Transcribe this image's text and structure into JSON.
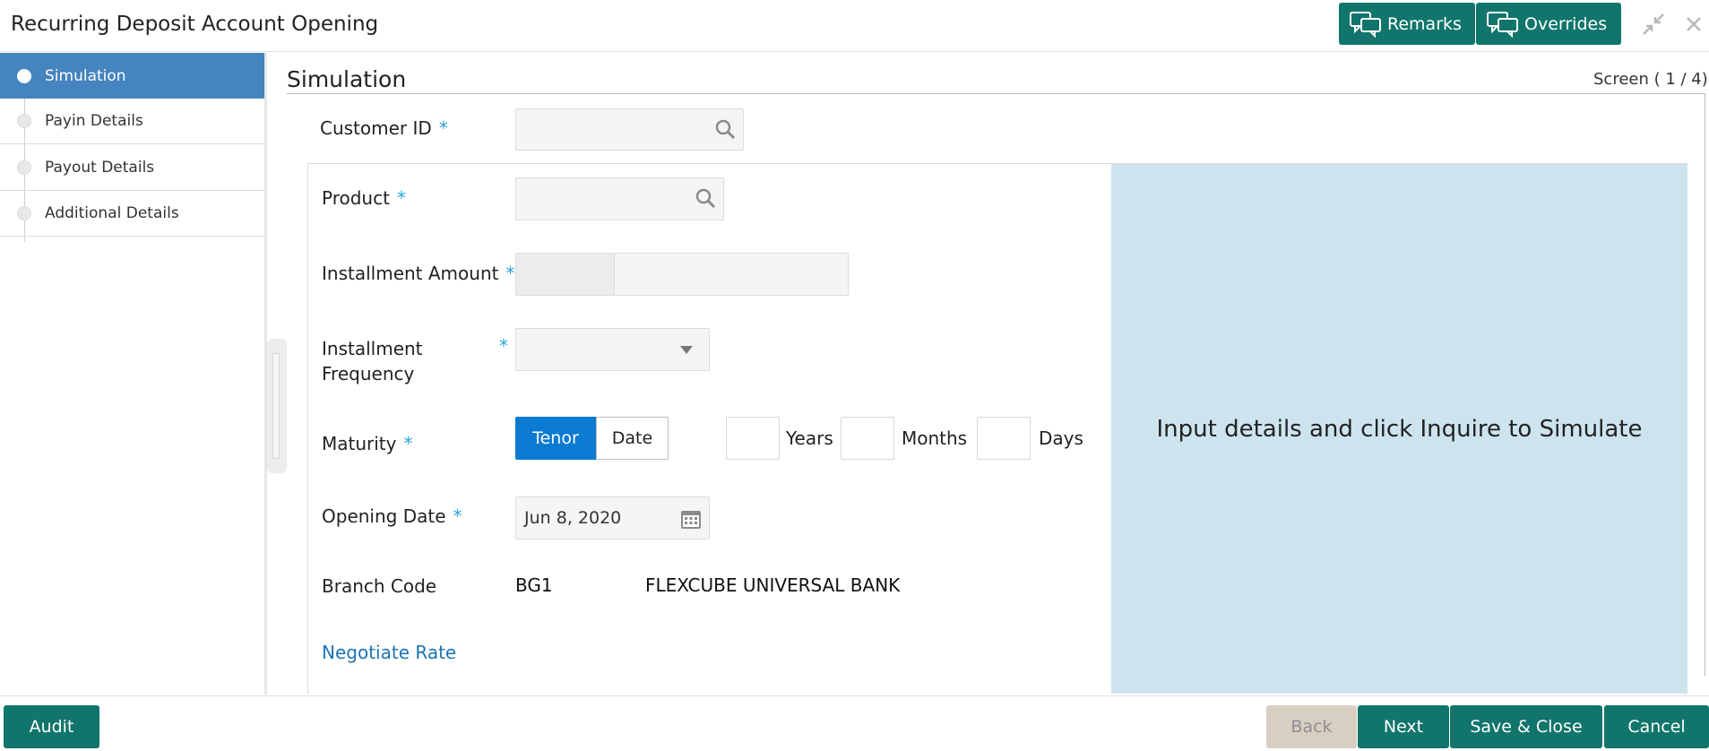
{
  "header": {
    "title": "Recurring Deposit Account Opening",
    "remarks_label": "Remarks",
    "overrides_label": "Overrides"
  },
  "sidebar": {
    "items": [
      {
        "label": "Simulation",
        "active": true
      },
      {
        "label": "Payin Details",
        "active": false
      },
      {
        "label": "Payout Details",
        "active": false
      },
      {
        "label": "Additional Details",
        "active": false
      }
    ]
  },
  "main": {
    "section_title": "Simulation",
    "screen_indicator": "Screen ( 1 / 4)",
    "form": {
      "customer_id_label": "Customer ID",
      "customer_id_value": "",
      "product_label": "Product",
      "product_value": "",
      "installment_amount_label": "Installment Amount",
      "installment_currency": "",
      "installment_amount_value": "",
      "installment_frequency_label_line1": "Installment",
      "installment_frequency_label_line2": "Frequency",
      "installment_frequency_value": "",
      "maturity_label": "Maturity",
      "maturity_options": [
        "Tenor",
        "Date"
      ],
      "maturity_selected": "Tenor",
      "years_label": "Years",
      "months_label": "Months",
      "days_label": "Days",
      "years_value": "",
      "months_value": "",
      "days_value": "",
      "opening_date_label": "Opening Date",
      "opening_date_value": "Jun 8, 2020",
      "branch_code_label": "Branch Code",
      "branch_code_value": "BG1",
      "branch_name": "FLEXCUBE UNIVERSAL BANK",
      "negotiate_rate_label": "Negotiate Rate",
      "required_marker": "*"
    },
    "simulation_message": "Input details and click Inquire to Simulate"
  },
  "footer": {
    "audit_label": "Audit",
    "back_label": "Back",
    "next_label": "Next",
    "save_close_label": "Save & Close",
    "cancel_label": "Cancel"
  },
  "colors": {
    "primary_teal": "#11756b",
    "active_blue": "#4484bf",
    "tenor_blue": "#0b7ad1",
    "sim_panel": "#cde4ef",
    "required": "#2aa5d8",
    "link": "#1b74b5"
  }
}
